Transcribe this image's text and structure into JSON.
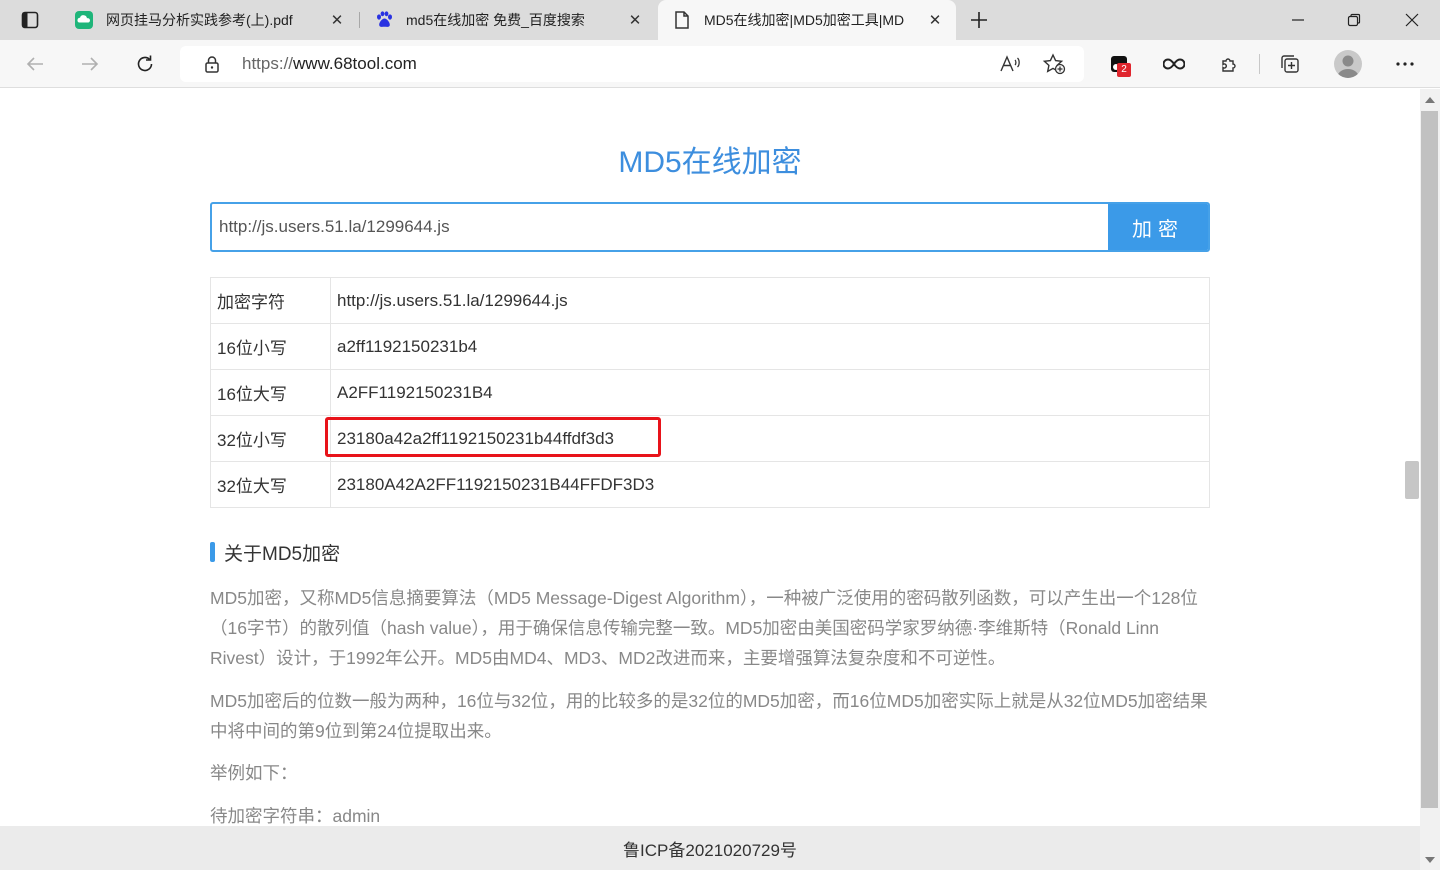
{
  "tabs": [
    {
      "title": "网页挂马分析实践参考(上).pdf",
      "icon": "pdf-cloud-icon"
    },
    {
      "title": "md5在线加密 免费_百度搜索",
      "icon": "baidu-paw-icon"
    },
    {
      "title": "MD5在线加密|MD5加密工具|MD",
      "icon": "page-icon"
    }
  ],
  "address": {
    "scheme": "https://",
    "host": "www.68tool.com"
  },
  "toolbar": {
    "extension_badge": "2"
  },
  "page": {
    "title": "MD5在线加密",
    "input_value": "http://js.users.51.la/1299644.js",
    "encrypt_button": "加密",
    "rows": [
      {
        "label": "加密字符",
        "value": "http://js.users.51.la/1299644.js"
      },
      {
        "label": "16位小写",
        "value": "a2ff1192150231b4"
      },
      {
        "label": "16位大写",
        "value": "A2FF1192150231B4"
      },
      {
        "label": "32位小写",
        "value": "23180a42a2ff1192150231b44ffdf3d3"
      },
      {
        "label": "32位大写",
        "value": "23180A42A2FF1192150231B44FFDF3D3"
      }
    ],
    "about_title": "关于MD5加密",
    "para1": "MD5加密，又称MD5信息摘要算法（MD5 Message-Digest Algorithm），一种被广泛使用的密码散列函数，可以产生出一个128位（16字节）的散列值（hash value），用于确保信息传输完整一致。MD5加密由美国密码学家罗纳德·李维斯特（Ronald Linn Rivest）设计，于1992年公开。MD5由MD4、MD3、MD2改进而来，主要增强算法复杂度和不可逆性。",
    "para2": "MD5加密后的位数一般为两种，16位与32位，用的比较多的是32位的MD5加密，而16位MD5加密实际上就是从32位MD5加密结果中将中间的第9位到第24位提取出来。",
    "para3": "举例如下：",
    "para4": "待加密字符串：admin"
  },
  "footer": "鲁ICP备2021020729号",
  "colors": {
    "accent": "#3b9ae8",
    "title": "#3d8ede",
    "highlight": "#e8131a"
  }
}
